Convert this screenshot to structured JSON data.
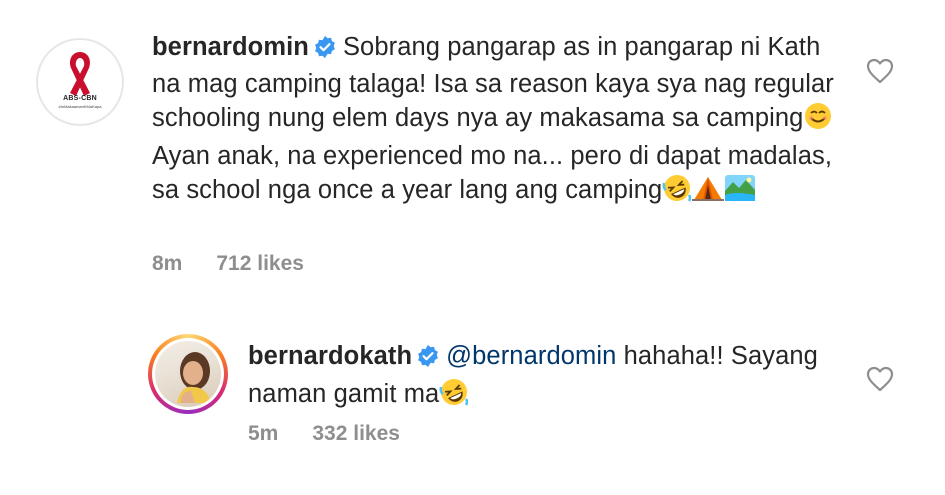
{
  "comments": [
    {
      "username": "bernardomin",
      "text": "Sobrang pangarap as in pangarap ni Kath na mag camping talaga! Isa sa reason kaya sya nag regular schooling nung elem days nya ay makasama sa camping",
      "text_after_emoji": "Ayan anak, na experienced mo na... pero di dapat madalas, sa school nga once a year lang ang camping",
      "time": "8m",
      "likes": "712 likes",
      "avatar_logo_text": "ABS-CBN",
      "avatar_logo_sub": "#InMakaamanKMaKapa",
      "emojis": [
        "smiling-face-icon",
        "rolling-laughing-icon",
        "tent-icon",
        "national-park-icon"
      ]
    },
    {
      "username": "bernardokath",
      "mention": "@bernardomin",
      "text": "hahaha!! Sayang naman gamit ma",
      "time": "5m",
      "likes": "332 likes",
      "emojis": [
        "rolling-laughing-icon"
      ]
    }
  ],
  "colors": {
    "text": "#262626",
    "meta": "#8e8e8e",
    "verified": "#3897f0",
    "mention": "#00376b",
    "ribbon": "#c8102e"
  }
}
